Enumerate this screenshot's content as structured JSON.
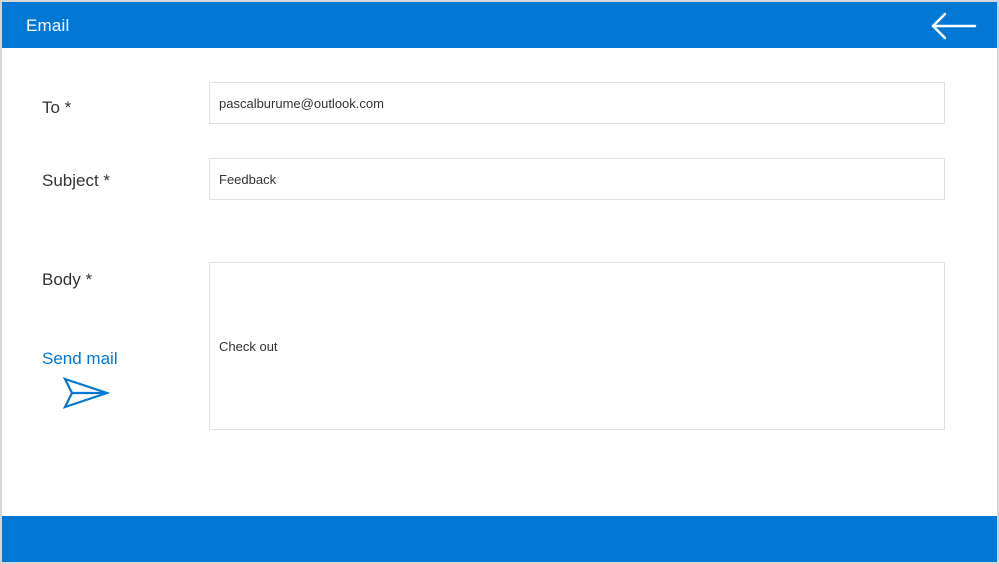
{
  "header": {
    "title": "Email",
    "back_icon": "arrow-left-icon"
  },
  "form": {
    "to": {
      "label": "To *",
      "value": "pascalburume@outlook.com"
    },
    "subject": {
      "label": "Subject *",
      "value": "Feedback"
    },
    "body": {
      "label": "Body *",
      "value": "Check out"
    }
  },
  "actions": {
    "send_label": "Send mail",
    "send_icon": "send-icon"
  },
  "colors": {
    "accent": "#0078d4",
    "text": "#333333",
    "border": "#e1e1e1"
  }
}
